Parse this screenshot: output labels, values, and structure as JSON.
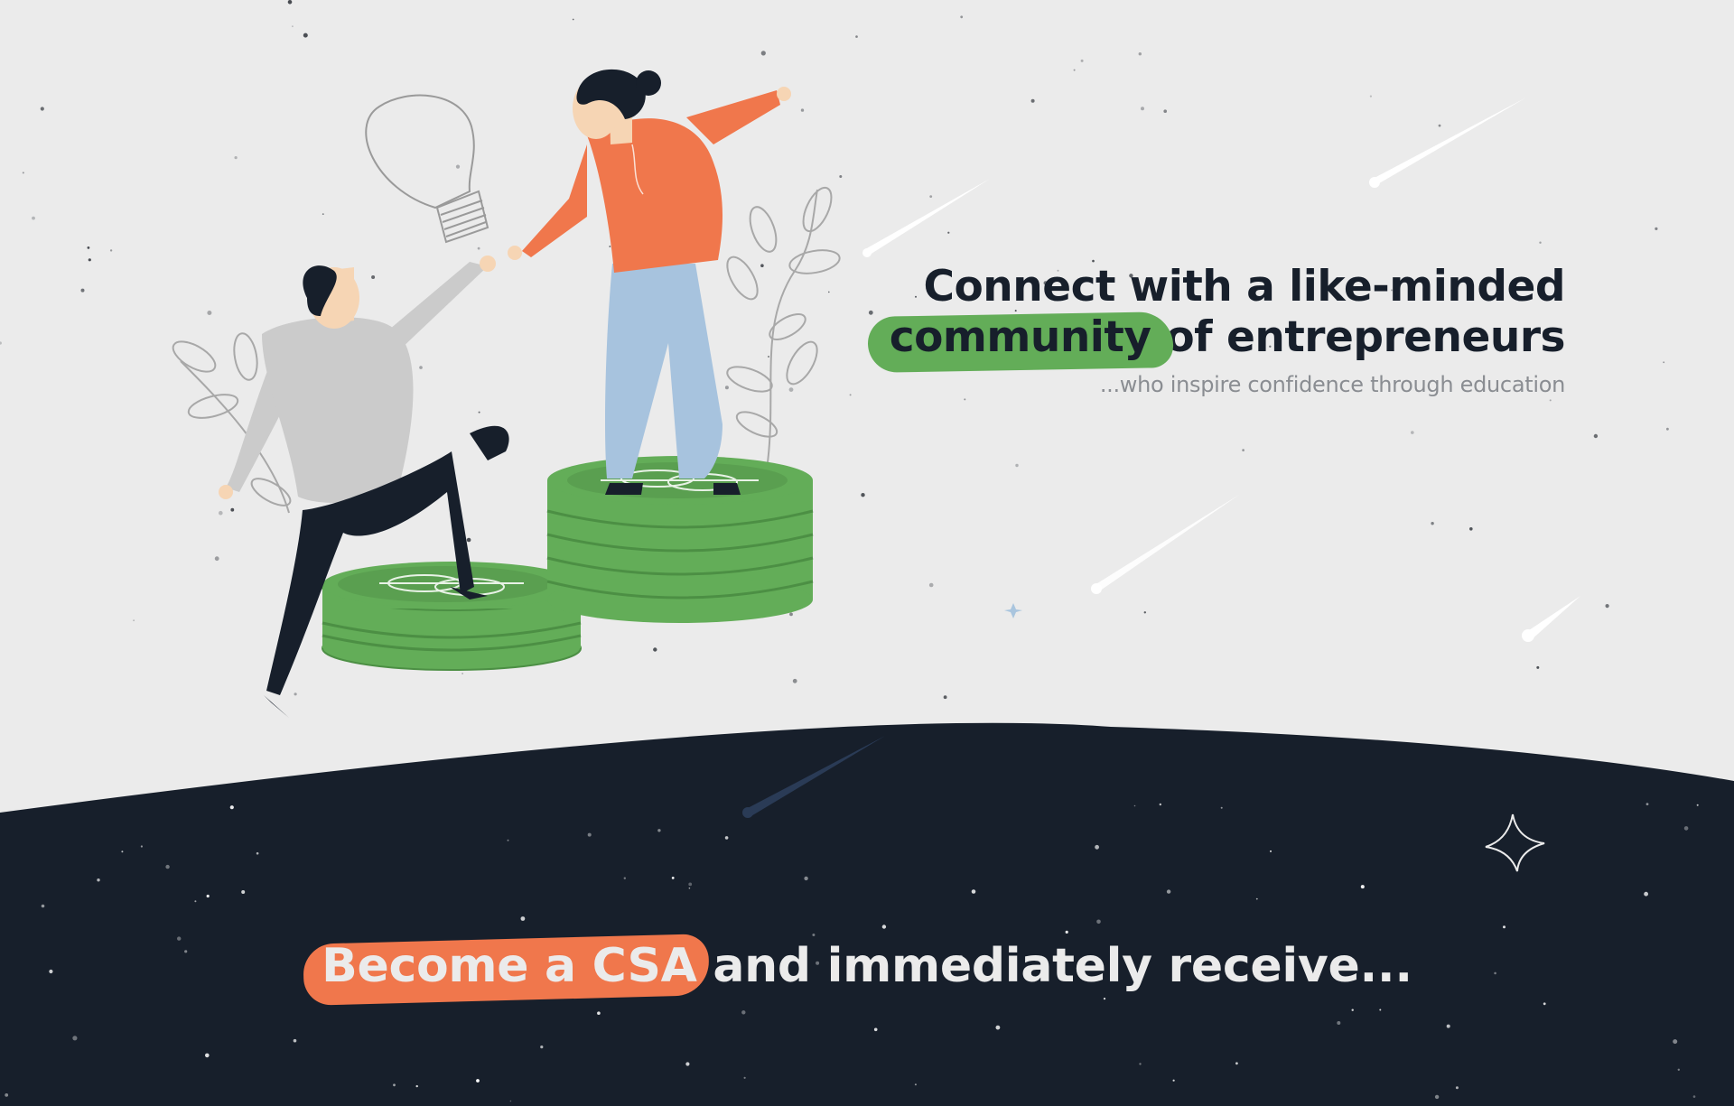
{
  "headline": {
    "line1": "Connect with a like-minded",
    "highlight": "community",
    "line2_rest": " of entrepreneurs",
    "subtitle": "...who inspire confidence through education"
  },
  "cta": {
    "highlight": "Become a CSA",
    "rest": " and immediately receive..."
  },
  "colors": {
    "background_light": "#ebebeb",
    "background_dark": "#171f2b",
    "accent_green": "#63ad58",
    "accent_orange": "#f0774c",
    "text_dark": "#171f2b"
  },
  "illustration": {
    "icons": [
      "lightbulb-icon",
      "leaf-branch-icon",
      "coin-stack-icon",
      "dollar-icon",
      "sparkle-star-icon",
      "shooting-star-icon"
    ]
  }
}
